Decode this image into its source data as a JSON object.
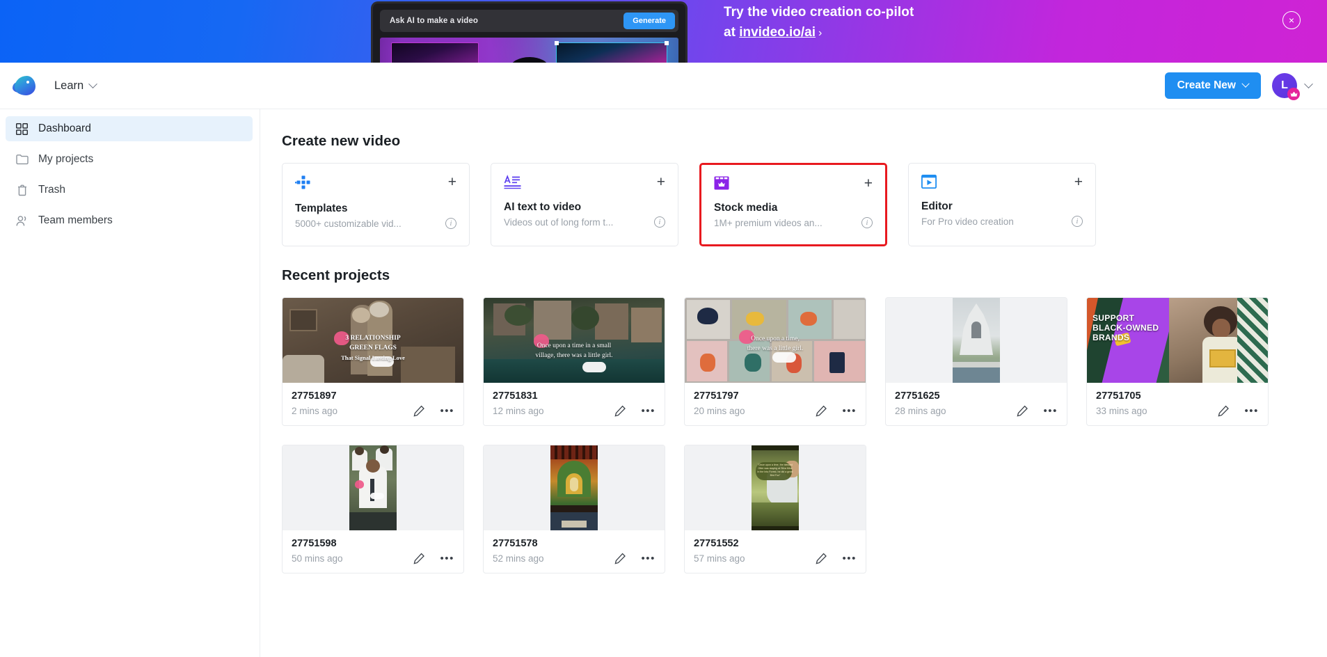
{
  "banner": {
    "ai_input_placeholder": "Ask AI to make a video",
    "generate_label": "Generate",
    "headline_line1": "Try the video creation co-pilot",
    "headline_prefix": "at ",
    "headline_link": "invideo.io/ai",
    "headline_chevron": "›",
    "close_label": "×",
    "gradient_start": "#0b63f6",
    "gradient_end": "#cf23d4"
  },
  "topnav": {
    "brand_name": "invideo-logo",
    "learn_label": "Learn",
    "create_new_label": "Create New",
    "avatar_initial": "L",
    "avatar_badge_icon": "crown-icon",
    "accent_blue": "#1f8ef1"
  },
  "sidebar": {
    "items": [
      {
        "label": "Dashboard",
        "icon": "grid-icon",
        "active": true
      },
      {
        "label": "My projects",
        "icon": "folder-icon",
        "active": false
      },
      {
        "label": "Trash",
        "icon": "trash-icon",
        "active": false
      },
      {
        "label": "Team members",
        "icon": "people-icon",
        "active": false
      }
    ],
    "active_background": "#e7f2fc"
  },
  "main": {
    "create_section_title": "Create new video",
    "recent_section_title": "Recent projects",
    "create_cards": [
      {
        "title": "Templates",
        "subtitle": "5000+ customizable vid...",
        "icon": "templates-icon",
        "plus": "+",
        "info": "i",
        "highlighted": false
      },
      {
        "title": "AI text to video",
        "subtitle": "Videos out of long form t...",
        "icon": "text-to-video-icon",
        "plus": "+",
        "info": "i",
        "highlighted": false
      },
      {
        "title": "Stock media",
        "subtitle": "1M+ premium videos an...",
        "icon": "stock-media-icon",
        "plus": "+",
        "info": "i",
        "highlighted": true,
        "highlight_color": "#e8191f"
      },
      {
        "title": "Editor",
        "subtitle": "For Pro video creation",
        "icon": "editor-icon",
        "plus": "+",
        "info": "i",
        "highlighted": false
      }
    ],
    "projects": [
      {
        "name": "27751897",
        "time": "2 mins ago",
        "thumb": "relationship-green-flags",
        "caption": "3 RELATIONSHIP\nGREEN FLAGS\nThat Signal Lasting Love"
      },
      {
        "name": "27751831",
        "time": "12 mins ago",
        "thumb": "seaside-village",
        "caption": "Once upon a time in a small\nvillage, there was a little girl."
      },
      {
        "name": "27751797",
        "time": "20 mins ago",
        "thumb": "illustration-grid",
        "caption": "Once upon a time,\nthere was a little girl."
      },
      {
        "name": "27751625",
        "time": "28 mins ago",
        "thumb": "white-temple",
        "caption": ""
      },
      {
        "name": "27751705",
        "time": "33 mins ago",
        "thumb": "support-black-owned-brands",
        "caption": "SUPPORT\nBLACK-OWNED\nBRANDS"
      },
      {
        "name": "27751598",
        "time": "50 mins ago",
        "thumb": "graduation-selfie",
        "caption": ""
      },
      {
        "name": "27751578",
        "time": "52 mins ago",
        "thumb": "temple-interior",
        "caption": ""
      },
      {
        "name": "27751552",
        "time": "57 mins ago",
        "thumb": "field-kneeling",
        "caption": "Once upon a time, the blessed Otter was staying at Silva Mine in the Into Forest, he did a great Bird Fox"
      }
    ],
    "project_edit_icon": "pencil-icon",
    "project_more_icon": "more-dots-icon",
    "project_more_glyph": "•••"
  }
}
